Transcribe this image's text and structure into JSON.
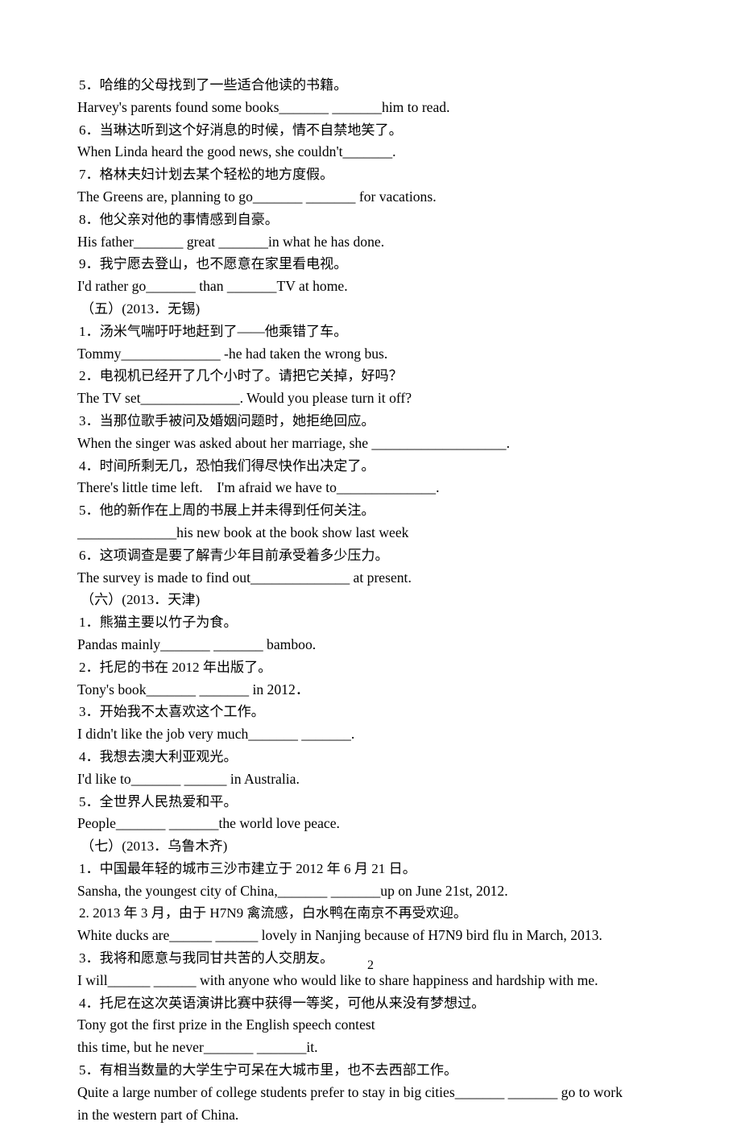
{
  "document": {
    "page_number": "2",
    "lines": [
      {
        "kind": "cn",
        "text": "5．哈维的父母找到了一些适合他读的书籍。"
      },
      {
        "kind": "en",
        "text": "Harvey's parents found some books_______ _______him to read."
      },
      {
        "kind": "cn",
        "text": "6．当琳达听到这个好消息的时候，情不自禁地笑了。"
      },
      {
        "kind": "en",
        "text": "When Linda heard the good news, she couldn't_______."
      },
      {
        "kind": "cn",
        "text": "7．格林夫妇计划去某个轻松的地方度假。"
      },
      {
        "kind": "en",
        "text": "The Greens are, planning to go_______ _______ for vacations."
      },
      {
        "kind": "cn",
        "text": "8．他父亲对他的事情感到自豪。"
      },
      {
        "kind": "en",
        "text": "His father_______ great _______in what he has done."
      },
      {
        "kind": "cn",
        "text": "9．我宁愿去登山，也不愿意在家里看电视。"
      },
      {
        "kind": "en",
        "text": "I'd rather go_______ than _______TV at home."
      },
      {
        "kind": "sec",
        "text": "（五）(2013．无锡)"
      },
      {
        "kind": "cn",
        "text": "1．汤米气喘吁吁地赶到了——他乘错了车。"
      },
      {
        "kind": "en",
        "text": "Tommy______________ -he had taken the wrong bus."
      },
      {
        "kind": "cn",
        "text": "2．电视机已经开了几个小时了。请把它关掉，好吗？"
      },
      {
        "kind": "en",
        "text": "The TV set______________. Would you please turn it off?"
      },
      {
        "kind": "cn",
        "text": "3．当那位歌手被问及婚姻问题时，她拒绝回应。"
      },
      {
        "kind": "en",
        "text": "When the singer was asked about her marriage, she ___________________."
      },
      {
        "kind": "cn",
        "text": "4．时间所剩无几，恐怕我们得尽快作出决定了。"
      },
      {
        "kind": "en",
        "text": "There's little time left.　I'm afraid we have to______________."
      },
      {
        "kind": "cn",
        "text": "5．他的新作在上周的书展上并未得到任何关注。"
      },
      {
        "kind": "en",
        "text": "______________his new book at the book show last week"
      },
      {
        "kind": "cn",
        "text": "6．这项调查是要了解青少年目前承受着多少压力。"
      },
      {
        "kind": "en",
        "text": "The survey is made to find out______________ at present."
      },
      {
        "kind": "sec",
        "text": "（六）(2013．天津)"
      },
      {
        "kind": "cn",
        "text": "1．熊猫主要以竹子为食。"
      },
      {
        "kind": "en",
        "text": "Pandas mainly_______ _______ bamboo."
      },
      {
        "kind": "cn",
        "text": "2．托尼的书在 2012 年出版了。"
      },
      {
        "kind": "en",
        "text": "Tony's book_______ _______ in 2012．"
      },
      {
        "kind": "cn",
        "text": "3．开始我不太喜欢这个工作。"
      },
      {
        "kind": "en",
        "text": "I didn't like the job very much_______ _______."
      },
      {
        "kind": "cn",
        "text": "4．我想去澳大利亚观光。"
      },
      {
        "kind": "en",
        "text": "I'd like to_______ ______ in Australia."
      },
      {
        "kind": "cn",
        "text": "5．全世界人民热爱和平。"
      },
      {
        "kind": "en",
        "text": "People_______ _______the world love peace."
      },
      {
        "kind": "sec",
        "text": "（七）(2013．乌鲁木齐)"
      },
      {
        "kind": "cn",
        "text": "1．中国最年轻的城市三沙市建立于 2012 年 6 月 21 日。"
      },
      {
        "kind": "en",
        "text": "Sansha, the youngest city of China,_______ _______up on June 21st, 2012."
      },
      {
        "kind": "cn",
        "text": "2. 2013 年 3 月，由于 H7N9 禽流感，白水鸭在南京不再受欢迎。"
      },
      {
        "kind": "en",
        "text": "White ducks are______ ______ lovely in Nanjing because of H7N9 bird flu in March, 2013."
      },
      {
        "kind": "cn",
        "text": "3．我将和愿意与我同甘共苦的人交朋友。"
      },
      {
        "kind": "en",
        "text": "I will______ ______ with anyone who would like to share happiness and hardship with me."
      },
      {
        "kind": "cn",
        "text": "4．托尼在这次英语演讲比赛中获得一等奖，可他从来没有梦想过。"
      },
      {
        "kind": "en",
        "text": "Tony got the first prize in the English speech contest"
      },
      {
        "kind": "en",
        "text": "this time, but he never_______ _______it."
      },
      {
        "kind": "cn",
        "text": "5．有相当数量的大学生宁可呆在大城市里，也不去西部工作。"
      },
      {
        "kind": "en",
        "text": "Quite a large number of college students prefer to stay in big cities_______ _______ go to work"
      },
      {
        "kind": "en",
        "text": "in the western part of China."
      }
    ]
  }
}
